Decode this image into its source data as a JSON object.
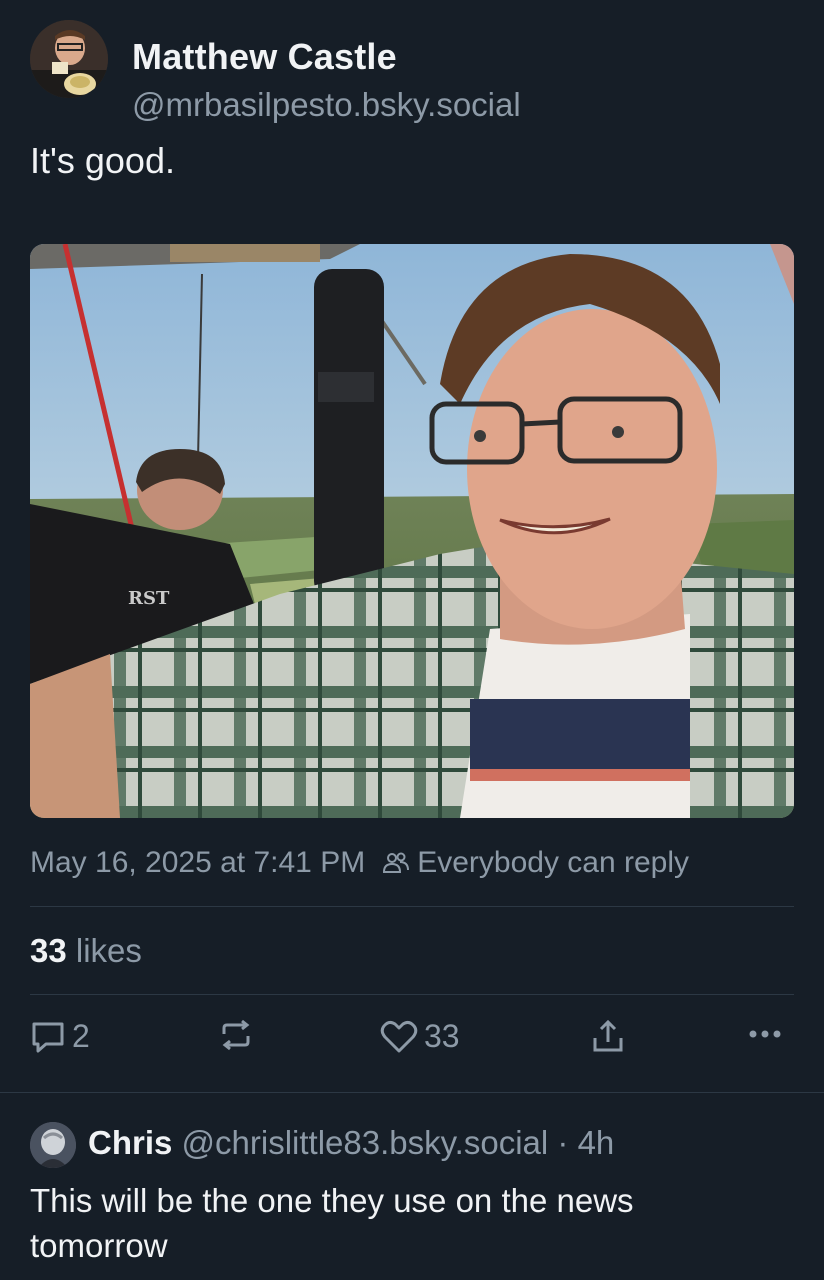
{
  "post": {
    "author_name": "Matthew Castle",
    "author_handle": "@mrbasilpesto.bsky.social",
    "text": "It's good.",
    "timestamp": "May 16, 2025 at 7:41 PM",
    "reply_setting": "Everybody can reply",
    "likes_count": "33",
    "likes_label": "likes",
    "image_shirt_text": "RST"
  },
  "actions": {
    "reply_count": "2",
    "like_count": "33"
  },
  "icons": {
    "reply": "speech-bubble-icon",
    "repost": "repost-icon",
    "like": "heart-icon",
    "share": "share-icon",
    "more": "more-dots-icon",
    "audience": "people-icon"
  },
  "reply": {
    "author_name": "Chris",
    "author_handle": "@chrislittle83.bsky.social",
    "separator": "·",
    "age": "4h",
    "text": "This will be the one they use on the news tomorrow"
  },
  "colors": {
    "background": "#161e27",
    "text": "#f1f3f5",
    "muted": "#8d9aa7",
    "divider": "#2c3844"
  }
}
